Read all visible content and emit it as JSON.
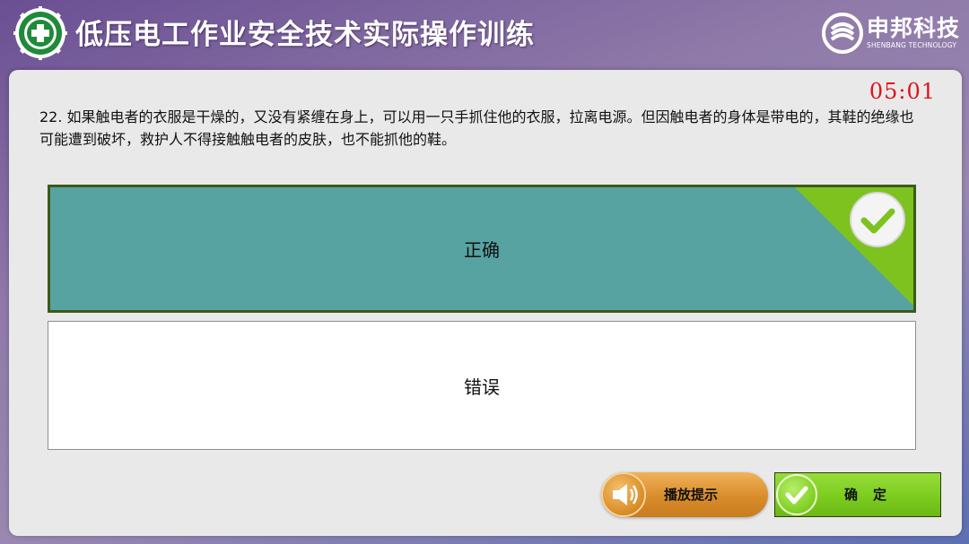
{
  "header": {
    "title": "低压电工作业安全技术实际操作训练",
    "brand_name": "申邦科技",
    "brand_sub": "SHENBANG TECHNOLOGY",
    "logo_icon": "safety-cross-logo",
    "brand_icon": "shenbang-logo"
  },
  "timer": "05:01",
  "question": {
    "text": "22. 如果触电者的衣服是干燥的，又没有紧缠在身上，可以用一只手抓住他的衣服，拉离电源。但因触电者的身体是带电的，其鞋的绝缘也可能遭到破坏，救护人不得接触触电者的皮肤，也不能抓他的鞋。"
  },
  "options": [
    {
      "label": "正确",
      "selected": true,
      "icon": "check-icon"
    },
    {
      "label": "错误",
      "selected": false
    }
  ],
  "buttons": {
    "hint_label": "播放提示",
    "hint_icon": "speaker-icon",
    "confirm_label": "确　定",
    "confirm_icon": "check-icon"
  },
  "colors": {
    "selected_option": "#56a3a2",
    "timer": "#e0121b",
    "confirm": "#7ccc1f",
    "hint": "#d88c2a"
  }
}
